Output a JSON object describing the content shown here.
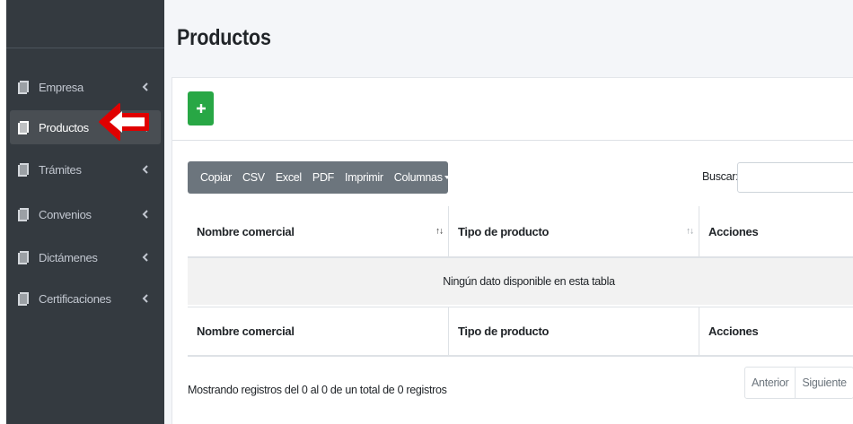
{
  "sidebar": {
    "items": [
      {
        "label": "Empresa",
        "icon": "file-icon",
        "active": false
      },
      {
        "label": "Productos",
        "icon": "file-icon",
        "active": true
      },
      {
        "label": "Trámites",
        "icon": "file-icon",
        "active": false
      },
      {
        "label": "Convenios",
        "icon": "file-icon",
        "active": false
      },
      {
        "label": "Dictámenes",
        "icon": "file-icon",
        "active": false
      },
      {
        "label": "Certificaciones",
        "icon": "file-icon",
        "active": false
      }
    ]
  },
  "page": {
    "title": "Productos"
  },
  "toolbar": {
    "add_label": "+",
    "buttons": [
      "Copiar",
      "CSV",
      "Excel",
      "PDF",
      "Imprimir",
      "Columnas"
    ]
  },
  "search": {
    "label": "Buscar:",
    "value": ""
  },
  "table": {
    "columns": [
      "Nombre comercial",
      "Tipo de producto",
      "Acciones"
    ],
    "empty_message": "Ningún dato disponible en esta tabla",
    "sort_glyph": "↑↓"
  },
  "footer": {
    "info": "Mostrando registros del 0 al 0 de un total de 0 registros",
    "prev_label": "Anterior",
    "next_label": "Siguiente"
  },
  "colors": {
    "sidebar_bg": "#343a40",
    "active_item_bg": "#494e53",
    "add_button": "#28a745",
    "button_group": "#6c757d",
    "annotation_arrow": "#e00000"
  }
}
